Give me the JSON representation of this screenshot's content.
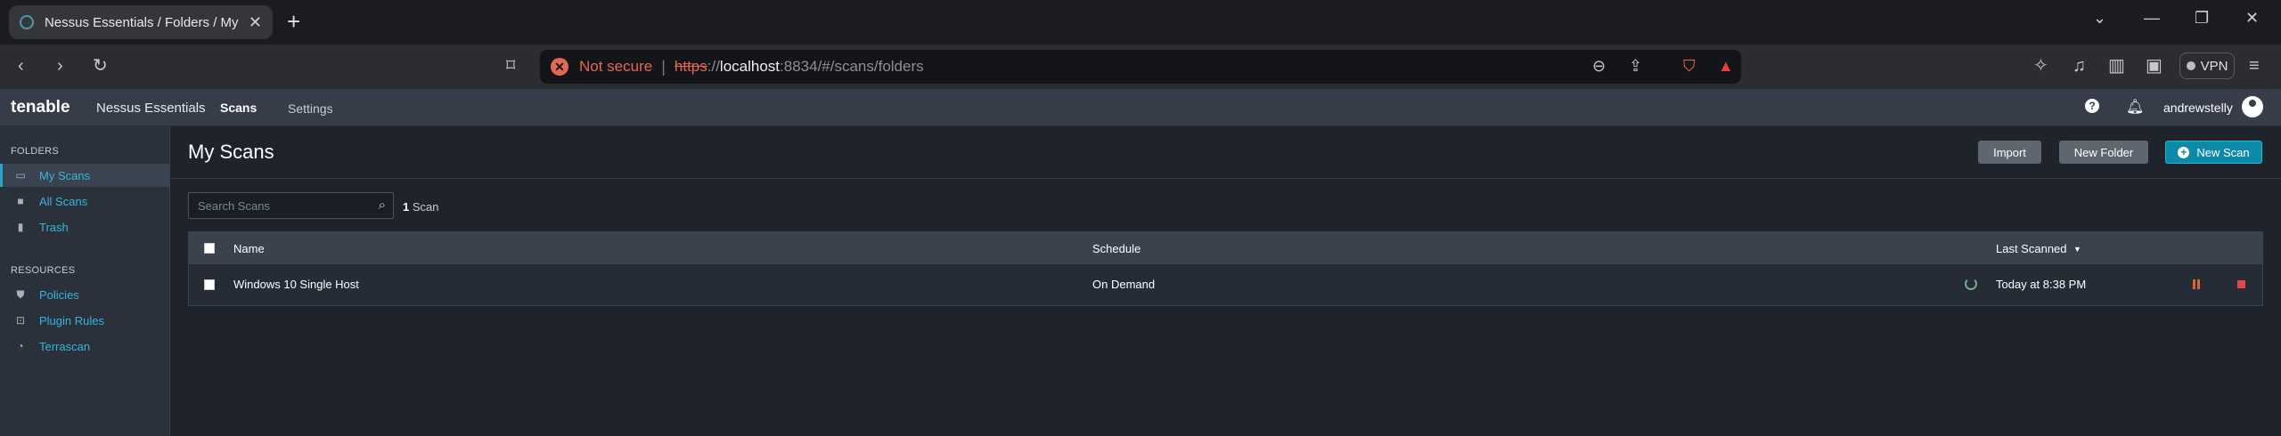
{
  "browser": {
    "tab_title": "Nessus Essentials / Folders / My",
    "not_secure": "Not secure",
    "url_scheme": "https",
    "url_sep": "://",
    "url_host": "localhost",
    "url_rest": ":8834/#/scans/folders",
    "vpn_label": "VPN"
  },
  "app": {
    "logo": "tenable",
    "product": "Nessus Essentials",
    "nav": {
      "scans": "Scans",
      "settings": "Settings"
    },
    "username": "andrewstelly"
  },
  "sidebar": {
    "folders_heading": "FOLDERS",
    "folders": [
      {
        "label": "My Scans",
        "icon": "folder-open-icon"
      },
      {
        "label": "All Scans",
        "icon": "folder-icon"
      },
      {
        "label": "Trash",
        "icon": "trash-icon"
      }
    ],
    "resources_heading": "RESOURCES",
    "resources": [
      {
        "label": "Policies",
        "icon": "shield-icon"
      },
      {
        "label": "Plugin Rules",
        "icon": "plugin-icon"
      },
      {
        "label": "Terrascan",
        "icon": "terrascan-icon"
      }
    ]
  },
  "main": {
    "title": "My Scans",
    "buttons": {
      "import": "Import",
      "new_folder": "New Folder",
      "new_scan": "New Scan"
    },
    "search_placeholder": "Search Scans",
    "count_number": "1",
    "count_label": "Scan",
    "table": {
      "headers": {
        "name": "Name",
        "schedule": "Schedule",
        "last_scanned": "Last Scanned"
      },
      "rows": [
        {
          "name": "Windows 10 Single Host",
          "schedule": "On Demand",
          "last_scanned": "Today at 8:38 PM"
        }
      ]
    }
  },
  "colors": {
    "accent": "#0d8aa8",
    "link": "#38b4dc",
    "danger": "#e06855"
  }
}
